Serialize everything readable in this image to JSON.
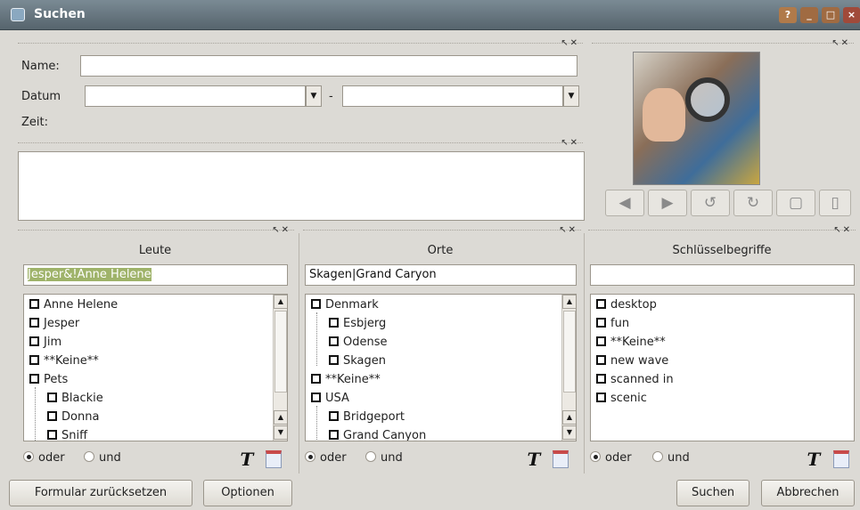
{
  "window": {
    "title": "Suchen",
    "help_icon": "help-icon",
    "min_icon": "minimize-icon",
    "max_icon": "maximize-icon",
    "close_icon": "close-icon"
  },
  "form": {
    "name_label": "Name:",
    "name_value": "",
    "date_label": "Datum",
    "date_from": "",
    "date_sep": "-",
    "date_to": "",
    "time_label": "Zeit:"
  },
  "preview_nav": [
    "back",
    "forward",
    "rotate-left",
    "rotate-right",
    "fit",
    "page"
  ],
  "columns": [
    {
      "title": "Leute",
      "filter": "Jesper&!Anne Helene",
      "items": [
        {
          "label": "Anne Helene",
          "level": 0
        },
        {
          "label": "Jesper",
          "level": 0
        },
        {
          "label": "Jim",
          "level": 0
        },
        {
          "label": "**Keine**",
          "level": 0
        },
        {
          "label": "Pets",
          "level": 0
        },
        {
          "label": "Blackie",
          "level": 1
        },
        {
          "label": "Donna",
          "level": 1
        },
        {
          "label": "Sniff",
          "level": 1
        }
      ],
      "radio_or": "oder",
      "radio_and": "und",
      "selected": "oder"
    },
    {
      "title": "Orte",
      "filter": "Skagen|Grand Caryon",
      "items": [
        {
          "label": "Denmark",
          "level": 0
        },
        {
          "label": "Esbjerg",
          "level": 1
        },
        {
          "label": "Odense",
          "level": 1
        },
        {
          "label": "Skagen",
          "level": 1
        },
        {
          "label": "**Keine**",
          "level": 0
        },
        {
          "label": "USA",
          "level": 0
        },
        {
          "label": "Bridgeport",
          "level": 1
        },
        {
          "label": "Grand Canyon",
          "level": 1
        }
      ],
      "radio_or": "oder",
      "radio_and": "und",
      "selected": "oder"
    },
    {
      "title": "Schlüsselbegriffe",
      "filter": "",
      "items": [
        {
          "label": "desktop",
          "level": 0
        },
        {
          "label": "fun",
          "level": 0
        },
        {
          "label": "**Keine**",
          "level": 0
        },
        {
          "label": "new wave",
          "level": 0
        },
        {
          "label": "scanned in",
          "level": 0
        },
        {
          "label": "scenic",
          "level": 0
        }
      ],
      "radio_or": "oder",
      "radio_and": "und",
      "selected": "oder"
    }
  ],
  "buttons": {
    "reset": "Formular zurücksetzen",
    "options": "Optionen",
    "search": "Suchen",
    "cancel": "Abbrechen"
  }
}
